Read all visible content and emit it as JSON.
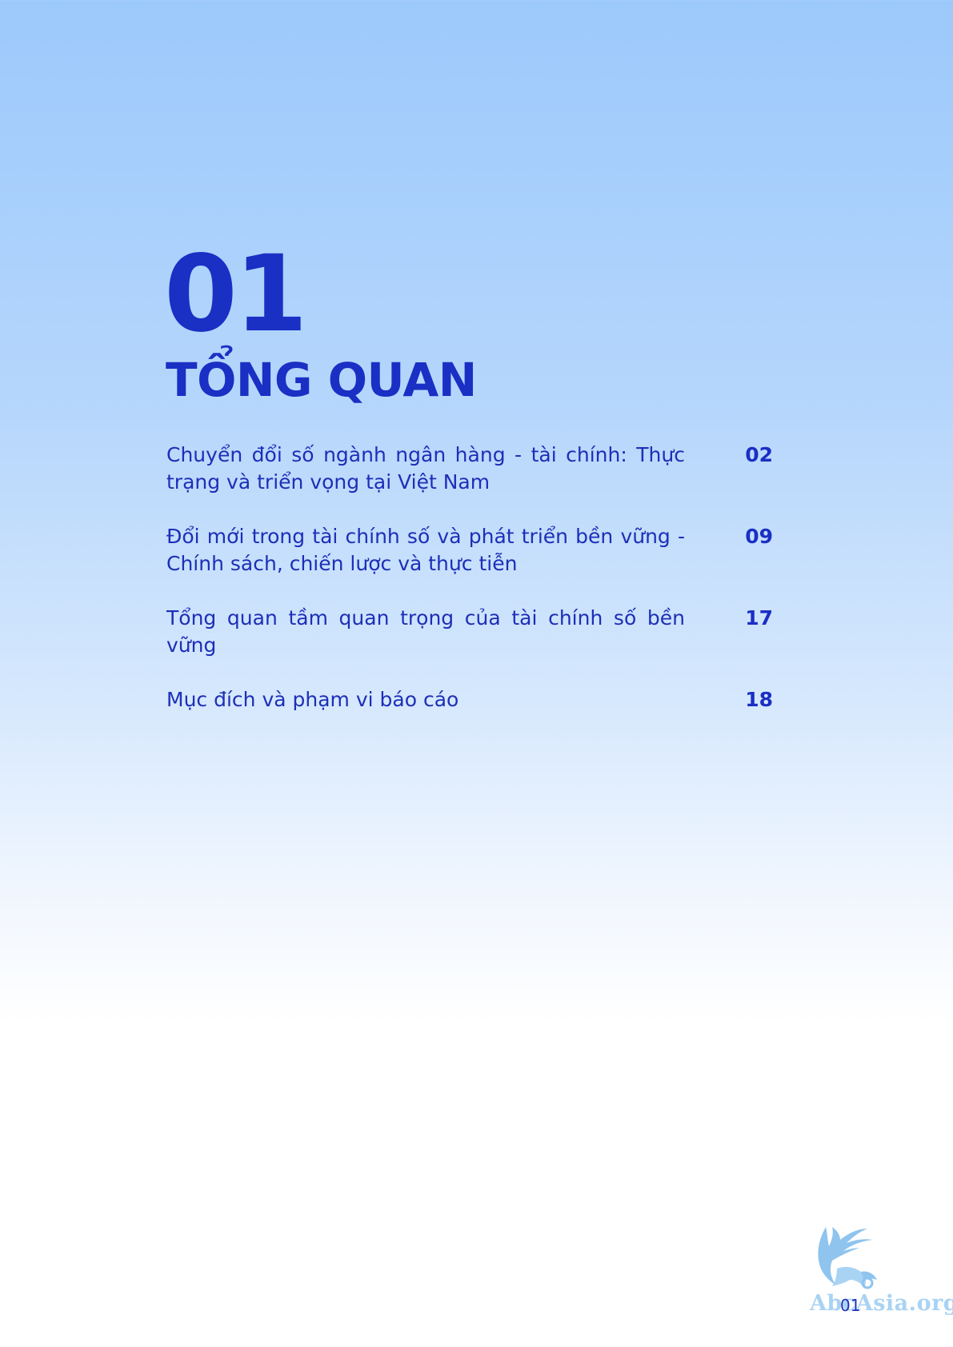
{
  "chapter": {
    "number": "01",
    "title": "TỔNG QUAN"
  },
  "toc": [
    {
      "label": "Chuyển đổi số ngành ngân hàng - tài chính: Thực trạng và triển vọng tại Việt Nam",
      "page": "02"
    },
    {
      "label": "Đổi mới trong tài chính số và phát triển bền vững - Chính sách, chiến lược và thực tiễn",
      "page": "09"
    },
    {
      "label": "Tổng quan tầm quan trọng của tài chính số bền vững",
      "page": "17"
    },
    {
      "label": "Mục đích và phạm vi báo cáo",
      "page": "18"
    }
  ],
  "footer": {
    "page_number": "01",
    "watermark": "AbcAsia.org"
  },
  "colors": {
    "accent": "#1a2fc4",
    "text": "#1d2fb8",
    "gradient_top": "#9cc9fb",
    "watermark": "#a9d3f3"
  }
}
